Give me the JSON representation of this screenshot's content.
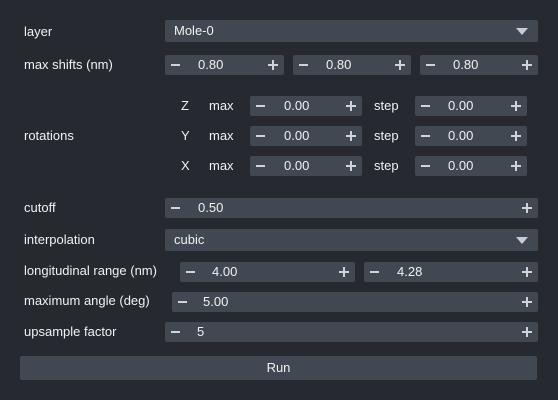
{
  "layer": {
    "label": "layer",
    "value": "Mole-0"
  },
  "max_shifts": {
    "label": "max shifts (nm)",
    "values": [
      "0.80",
      "0.80",
      "0.80"
    ]
  },
  "rotations": {
    "label": "rotations",
    "max_label": "max",
    "step_label": "step",
    "axes": [
      {
        "axis": "Z",
        "max": "0.00",
        "step": "0.00"
      },
      {
        "axis": "Y",
        "max": "0.00",
        "step": "0.00"
      },
      {
        "axis": "X",
        "max": "0.00",
        "step": "0.00"
      }
    ]
  },
  "cutoff": {
    "label": "cutoff",
    "value": "0.50"
  },
  "interpolation": {
    "label": "interpolation",
    "value": "cubic"
  },
  "longitudinal_range": {
    "label": "longitudinal range (nm)",
    "values": [
      "4.00",
      "4.28"
    ]
  },
  "maximum_angle": {
    "label": "maximum angle (deg)",
    "value": "5.00"
  },
  "upsample_factor": {
    "label": "upsample factor",
    "value": "5"
  },
  "run_button": {
    "label": "Run"
  },
  "colors": {
    "background": "#262930",
    "widget": "#414851",
    "text": "#f0f1f2"
  }
}
